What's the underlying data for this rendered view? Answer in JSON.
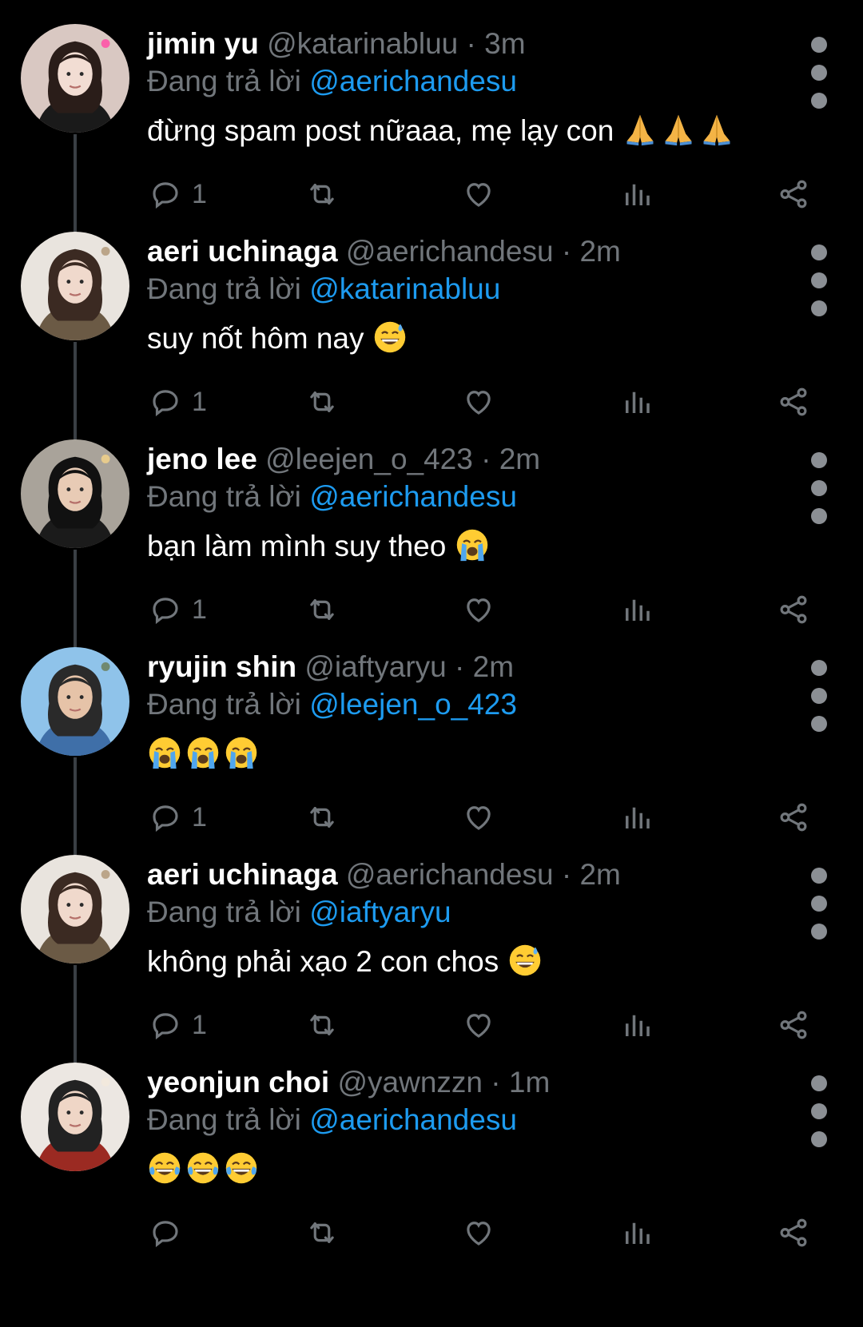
{
  "reply_prefix": "Đang trả lời",
  "tweets": [
    {
      "name": "jimin yu",
      "handle": "@katarinabluu",
      "time": "3m",
      "reply_to": "@aerichandesu",
      "text": "đừng spam post nữaaa, mẹ lạy con",
      "emojis": [
        "folded-hands-emoji",
        "folded-hands-emoji",
        "folded-hands-emoji"
      ],
      "reply_count": "1",
      "avatar": {
        "bg": "#d9c8c2",
        "hair": "#2a1d19",
        "skin": "#f2ddd3",
        "top": "#1a1a1a",
        "accent": "#ff4da6"
      }
    },
    {
      "name": "aeri uchinaga",
      "handle": "@aerichandesu",
      "time": "2m",
      "reply_to": "@katarinabluu",
      "text": "suy nốt hôm nay",
      "emojis": [
        "grinning-sweat-emoji"
      ],
      "reply_count": "1",
      "avatar": {
        "bg": "#e9e4de",
        "hair": "#3b2a22",
        "skin": "#f0d9cc",
        "top": "#6b5a45",
        "accent": "#b39a7a"
      }
    },
    {
      "name": "jeno lee",
      "handle": "@leejen_o_423",
      "time": "2m",
      "reply_to": "@aerichandesu",
      "text": "bạn làm mình suy theo",
      "emojis": [
        "loudly-crying-emoji"
      ],
      "reply_count": "1",
      "avatar": {
        "bg": "#a9a39a",
        "hair": "#111111",
        "skin": "#e8cbb5",
        "top": "#1b1b1b",
        "accent": "#f2d28a"
      }
    },
    {
      "name": "ryujin shin",
      "handle": "@iaftyaryu",
      "time": "2m",
      "reply_to": "@leejen_o_423",
      "text": "",
      "emojis": [
        "loudly-crying-emoji",
        "loudly-crying-emoji",
        "loudly-crying-emoji"
      ],
      "reply_count": "1",
      "avatar": {
        "bg": "#8fc3ea",
        "hair": "#2a2a2a",
        "skin": "#e6c3a8",
        "top": "#3f6fa8",
        "accent": "#6b7f5a"
      }
    },
    {
      "name": "aeri uchinaga",
      "handle": "@aerichandesu",
      "time": "2m",
      "reply_to": "@iaftyaryu",
      "text": "không phải xạo 2 con chos",
      "emojis": [
        "grinning-sweat-emoji"
      ],
      "reply_count": "1",
      "avatar": {
        "bg": "#e9e4de",
        "hair": "#3b2a22",
        "skin": "#f0d9cc",
        "top": "#6b5a45",
        "accent": "#b39a7a"
      }
    },
    {
      "name": "yeonjun choi",
      "handle": "@yawnzzn",
      "time": "1m",
      "reply_to": "@aerichandesu",
      "text": "",
      "emojis": [
        "tears-of-joy-emoji",
        "tears-of-joy-emoji",
        "tears-of-joy-emoji"
      ],
      "reply_count": "",
      "avatar": {
        "bg": "#ece7e2",
        "hair": "#222222",
        "skin": "#efd6c6",
        "top": "#9b2a22",
        "accent": "#f3e9dc"
      }
    }
  ],
  "colors": {
    "background": "#000000",
    "name": "#ffffff",
    "muted": "#71767b",
    "mention": "#1d9bf0",
    "thread_line": "#3a3f44"
  }
}
